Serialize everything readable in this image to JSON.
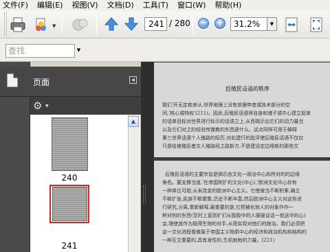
{
  "menu": {
    "items": [
      "文件(F)",
      "编辑(E)",
      "视图(V)",
      "文档(D)",
      "工具(T)",
      "窗口(W)",
      "帮助(H)"
    ]
  },
  "toolbar": {
    "current_page": "241",
    "total_pages": "/ 280",
    "zoom": "31.2%",
    "zoom_out_glyph": "−",
    "zoom_in_glyph": "+",
    "icons": [
      "print-icon",
      "share-icon",
      "review-icon",
      "previous-page-icon",
      "next-page-icon",
      "zoom-out-icon",
      "zoom-in-icon",
      "fit-width-icon",
      "full-screen-icon"
    ]
  },
  "find": {
    "placeholder": "查找"
  },
  "panel": {
    "title": "页面",
    "thumbnails": [
      {
        "label": "240",
        "selected": false
      },
      {
        "label": "241",
        "selected": true
      }
    ]
  },
  "document": {
    "page1_title": "后殖民话语的秩序",
    "page1_lines": [
      "我们'开无定疾来从,世界地理上没有依据申查或技术部分的空",
      "间,'核心或特权'(211)。因此,后殖民话语将自身和诸子或中心建立起来",
      "的话单目标对世界进行标示的话语之上,从而揭示出它们的动力最当",
      "以及它们对之的经验传媒教的东西是什么。这点同样可用于解释",
      "第三世界话语个人殖路的经历,对此建行的批评使后殖民话语不仅仅",
      "只是给被殖民者文人殖路经之路新方,不是建设定边缘新的那些文"
    ],
    "page2_lines": [
      "后殖民话语的主要宗旨是揭示由文化一政治中心和所对的的边缘",
      "角色。要支撑当道,'在帝国附扩的文化(中心),'欧洲文化中心存有",
      "一种单位可超,从未改变的欧洲中心主义。它使被当不断积累,确立",
      "不断扩张,民族不断聚集,历史不断丰富;然后欧洲中心主义对这些进",
      "行研究,分离,重新解释,最重要的是,它把被化他人的对象作作一",
      "种对别的东西(至时上直到扩们从胶胶中的人服服谈话一就这中的心)",
      "会,理使其作为既得生物的对手,从而实现对他们的统治。我们必须把",
      "这一文化进程看做属于帝国主义物质中心的经济和政治机构和结构的",
      "一种互文重要的,具有发性的,生机勃勃的力量。(221)"
    ]
  }
}
